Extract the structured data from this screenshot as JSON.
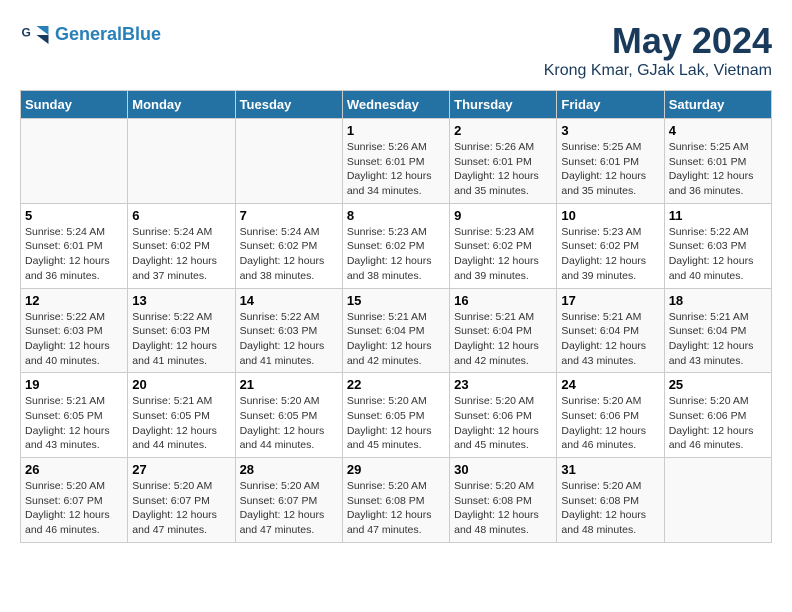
{
  "header": {
    "logo_line1": "General",
    "logo_line2": "Blue",
    "month_title": "May 2024",
    "location": "Krong Kmar, GJak Lak, Vietnam"
  },
  "weekdays": [
    "Sunday",
    "Monday",
    "Tuesday",
    "Wednesday",
    "Thursday",
    "Friday",
    "Saturday"
  ],
  "weeks": [
    [
      {
        "day": "",
        "info": ""
      },
      {
        "day": "",
        "info": ""
      },
      {
        "day": "",
        "info": ""
      },
      {
        "day": "1",
        "info": "Sunrise: 5:26 AM\nSunset: 6:01 PM\nDaylight: 12 hours\nand 34 minutes."
      },
      {
        "day": "2",
        "info": "Sunrise: 5:26 AM\nSunset: 6:01 PM\nDaylight: 12 hours\nand 35 minutes."
      },
      {
        "day": "3",
        "info": "Sunrise: 5:25 AM\nSunset: 6:01 PM\nDaylight: 12 hours\nand 35 minutes."
      },
      {
        "day": "4",
        "info": "Sunrise: 5:25 AM\nSunset: 6:01 PM\nDaylight: 12 hours\nand 36 minutes."
      }
    ],
    [
      {
        "day": "5",
        "info": "Sunrise: 5:24 AM\nSunset: 6:01 PM\nDaylight: 12 hours\nand 36 minutes."
      },
      {
        "day": "6",
        "info": "Sunrise: 5:24 AM\nSunset: 6:02 PM\nDaylight: 12 hours\nand 37 minutes."
      },
      {
        "day": "7",
        "info": "Sunrise: 5:24 AM\nSunset: 6:02 PM\nDaylight: 12 hours\nand 38 minutes."
      },
      {
        "day": "8",
        "info": "Sunrise: 5:23 AM\nSunset: 6:02 PM\nDaylight: 12 hours\nand 38 minutes."
      },
      {
        "day": "9",
        "info": "Sunrise: 5:23 AM\nSunset: 6:02 PM\nDaylight: 12 hours\nand 39 minutes."
      },
      {
        "day": "10",
        "info": "Sunrise: 5:23 AM\nSunset: 6:02 PM\nDaylight: 12 hours\nand 39 minutes."
      },
      {
        "day": "11",
        "info": "Sunrise: 5:22 AM\nSunset: 6:03 PM\nDaylight: 12 hours\nand 40 minutes."
      }
    ],
    [
      {
        "day": "12",
        "info": "Sunrise: 5:22 AM\nSunset: 6:03 PM\nDaylight: 12 hours\nand 40 minutes."
      },
      {
        "day": "13",
        "info": "Sunrise: 5:22 AM\nSunset: 6:03 PM\nDaylight: 12 hours\nand 41 minutes."
      },
      {
        "day": "14",
        "info": "Sunrise: 5:22 AM\nSunset: 6:03 PM\nDaylight: 12 hours\nand 41 minutes."
      },
      {
        "day": "15",
        "info": "Sunrise: 5:21 AM\nSunset: 6:04 PM\nDaylight: 12 hours\nand 42 minutes."
      },
      {
        "day": "16",
        "info": "Sunrise: 5:21 AM\nSunset: 6:04 PM\nDaylight: 12 hours\nand 42 minutes."
      },
      {
        "day": "17",
        "info": "Sunrise: 5:21 AM\nSunset: 6:04 PM\nDaylight: 12 hours\nand 43 minutes."
      },
      {
        "day": "18",
        "info": "Sunrise: 5:21 AM\nSunset: 6:04 PM\nDaylight: 12 hours\nand 43 minutes."
      }
    ],
    [
      {
        "day": "19",
        "info": "Sunrise: 5:21 AM\nSunset: 6:05 PM\nDaylight: 12 hours\nand 43 minutes."
      },
      {
        "day": "20",
        "info": "Sunrise: 5:21 AM\nSunset: 6:05 PM\nDaylight: 12 hours\nand 44 minutes."
      },
      {
        "day": "21",
        "info": "Sunrise: 5:20 AM\nSunset: 6:05 PM\nDaylight: 12 hours\nand 44 minutes."
      },
      {
        "day": "22",
        "info": "Sunrise: 5:20 AM\nSunset: 6:05 PM\nDaylight: 12 hours\nand 45 minutes."
      },
      {
        "day": "23",
        "info": "Sunrise: 5:20 AM\nSunset: 6:06 PM\nDaylight: 12 hours\nand 45 minutes."
      },
      {
        "day": "24",
        "info": "Sunrise: 5:20 AM\nSunset: 6:06 PM\nDaylight: 12 hours\nand 46 minutes."
      },
      {
        "day": "25",
        "info": "Sunrise: 5:20 AM\nSunset: 6:06 PM\nDaylight: 12 hours\nand 46 minutes."
      }
    ],
    [
      {
        "day": "26",
        "info": "Sunrise: 5:20 AM\nSunset: 6:07 PM\nDaylight: 12 hours\nand 46 minutes."
      },
      {
        "day": "27",
        "info": "Sunrise: 5:20 AM\nSunset: 6:07 PM\nDaylight: 12 hours\nand 47 minutes."
      },
      {
        "day": "28",
        "info": "Sunrise: 5:20 AM\nSunset: 6:07 PM\nDaylight: 12 hours\nand 47 minutes."
      },
      {
        "day": "29",
        "info": "Sunrise: 5:20 AM\nSunset: 6:08 PM\nDaylight: 12 hours\nand 47 minutes."
      },
      {
        "day": "30",
        "info": "Sunrise: 5:20 AM\nSunset: 6:08 PM\nDaylight: 12 hours\nand 48 minutes."
      },
      {
        "day": "31",
        "info": "Sunrise: 5:20 AM\nSunset: 6:08 PM\nDaylight: 12 hours\nand 48 minutes."
      },
      {
        "day": "",
        "info": ""
      }
    ]
  ]
}
